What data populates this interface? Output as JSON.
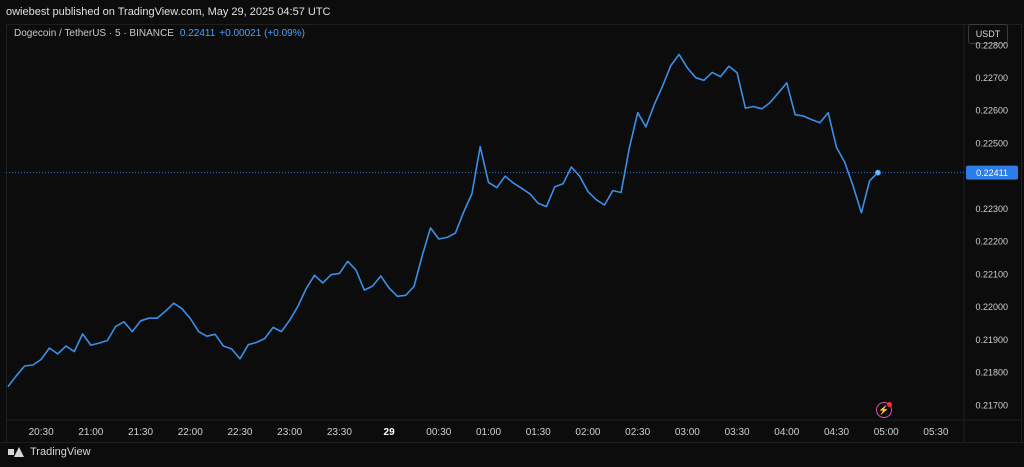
{
  "header": {
    "published": "owiebest published on TradingView.com, May 29, 2025 04:57 UTC"
  },
  "symbol": {
    "name": "Dogecoin / TetherUS · 5 · BINANCE",
    "price": "0.22411",
    "change": "+0.00021 (+0.09%)"
  },
  "currency_button": "USDT",
  "footer": {
    "brand": "TradingView"
  },
  "colors": {
    "background": "#0c0c0c",
    "line": "#3b8fe8",
    "price_label": "#2b7de9",
    "axis_text": "#cfcfcf",
    "grid": "#1c1c1c"
  },
  "chart_data": {
    "type": "line",
    "series": [
      {
        "values": [
          0.21757,
          0.2179,
          0.2182,
          0.21823,
          0.2184,
          0.21875,
          0.21857,
          0.21881,
          0.21864,
          0.21918,
          0.21884,
          0.2189,
          0.21898,
          0.21941,
          0.21955,
          0.21925,
          0.21958,
          0.21966,
          0.21966,
          0.21987,
          0.22012,
          0.21995,
          0.21965,
          0.21925,
          0.21911,
          0.21917,
          0.21881,
          0.21872,
          0.21842,
          0.21885,
          0.21892,
          0.21904,
          0.21938,
          0.21925,
          0.2196,
          0.22003,
          0.22057,
          0.22097,
          0.22074,
          0.22099,
          0.22103,
          0.2214,
          0.22113,
          0.22052,
          0.22064,
          0.22095,
          0.22058,
          0.22033,
          0.22036,
          0.22063,
          0.22158,
          0.22242,
          0.22208,
          0.22213,
          0.22226,
          0.22291,
          0.22347,
          0.2249,
          0.22381,
          0.22365,
          0.224,
          0.22379,
          0.22363,
          0.22346,
          0.22317,
          0.22307,
          0.22368,
          0.22377,
          0.22428,
          0.224,
          0.22353,
          0.22328,
          0.22312,
          0.22356,
          0.2235,
          0.22487,
          0.22594,
          0.22551,
          0.22618,
          0.22675,
          0.22738,
          0.22772,
          0.22731,
          0.22701,
          0.22693,
          0.22717,
          0.22704,
          0.22736,
          0.22716,
          0.22608,
          0.22613,
          0.22606,
          0.22625,
          0.22655,
          0.22685,
          0.22588,
          0.22584,
          0.22573,
          0.22563,
          0.22594,
          0.22488,
          0.22442,
          0.2237,
          0.22288,
          0.22386,
          0.22411
        ]
      }
    ],
    "x_start": "20:10",
    "x_interval_minutes": 5,
    "x_ticks": [
      "20:30",
      "21:00",
      "21:30",
      "22:00",
      "22:30",
      "23:00",
      "23:30",
      "29",
      "00:30",
      "01:00",
      "01:30",
      "02:00",
      "02:30",
      "03:00",
      "03:30",
      "04:00",
      "04:30",
      "05:00",
      "05:30"
    ],
    "y_ticks": [
      "0.22800",
      "0.22700",
      "0.22600",
      "0.22500",
      "0.22400",
      "0.22300",
      "0.22200",
      "0.22100",
      "0.22000",
      "0.21900",
      "0.21800",
      "0.21700"
    ],
    "ylim": [
      0.21655,
      0.22865
    ],
    "last_value": "0.22411",
    "grid": false
  }
}
